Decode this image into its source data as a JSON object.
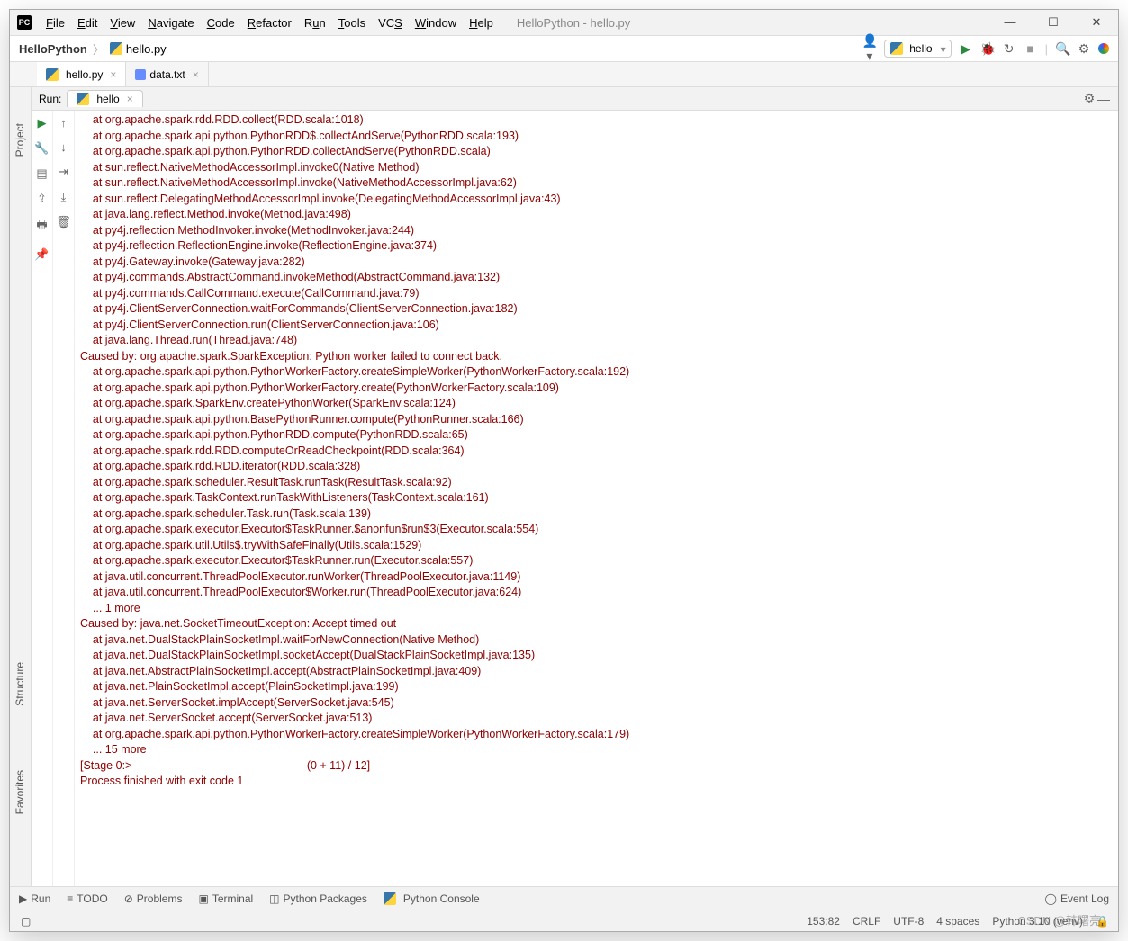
{
  "window": {
    "title_path": "HelloPython - hello.py"
  },
  "menu": [
    "File",
    "Edit",
    "View",
    "Navigate",
    "Code",
    "Refactor",
    "Run",
    "Tools",
    "VCS",
    "Window",
    "Help"
  ],
  "breadcrumb": {
    "root": "HelloPython",
    "file": "hello.py"
  },
  "run_config": "hello",
  "editor_tabs": [
    {
      "name": "hello.py",
      "kind": "py",
      "active": true
    },
    {
      "name": "data.txt",
      "kind": "txt",
      "active": false
    }
  ],
  "sidebars": {
    "project": "Project",
    "structure": "Structure",
    "favorites": "Favorites"
  },
  "run_panel": {
    "label": "Run:",
    "tab": "hello",
    "lines": [
      {
        "i": 1,
        "t": "    at org.apache.spark.rdd.RDD.collect(RDD.scala:1018)"
      },
      {
        "i": 1,
        "t": "    at org.apache.spark.api.python.PythonRDD$.collectAndServe(PythonRDD.scala:193)"
      },
      {
        "i": 1,
        "t": "    at org.apache.spark.api.python.PythonRDD.collectAndServe(PythonRDD.scala)"
      },
      {
        "i": 1,
        "t": "    at sun.reflect.NativeMethodAccessorImpl.invoke0(Native Method)"
      },
      {
        "i": 1,
        "t": "    at sun.reflect.NativeMethodAccessorImpl.invoke(NativeMethodAccessorImpl.java:62)"
      },
      {
        "i": 1,
        "t": "    at sun.reflect.DelegatingMethodAccessorImpl.invoke(DelegatingMethodAccessorImpl.java:43)"
      },
      {
        "i": 1,
        "t": "    at java.lang.reflect.Method.invoke(Method.java:498)"
      },
      {
        "i": 1,
        "t": "    at py4j.reflection.MethodInvoker.invoke(MethodInvoker.java:244)"
      },
      {
        "i": 1,
        "t": "    at py4j.reflection.ReflectionEngine.invoke(ReflectionEngine.java:374)"
      },
      {
        "i": 1,
        "t": "    at py4j.Gateway.invoke(Gateway.java:282)"
      },
      {
        "i": 1,
        "t": "    at py4j.commands.AbstractCommand.invokeMethod(AbstractCommand.java:132)"
      },
      {
        "i": 1,
        "t": "    at py4j.commands.CallCommand.execute(CallCommand.java:79)"
      },
      {
        "i": 1,
        "t": "    at py4j.ClientServerConnection.waitForCommands(ClientServerConnection.java:182)"
      },
      {
        "i": 1,
        "t": "    at py4j.ClientServerConnection.run(ClientServerConnection.java:106)"
      },
      {
        "i": 1,
        "t": "    at java.lang.Thread.run(Thread.java:748)"
      },
      {
        "i": 0,
        "t": "Caused by: org.apache.spark.SparkException: Python worker failed to connect back."
      },
      {
        "i": 1,
        "t": "    at org.apache.spark.api.python.PythonWorkerFactory.createSimpleWorker(PythonWorkerFactory.scala:192)"
      },
      {
        "i": 1,
        "t": "    at org.apache.spark.api.python.PythonWorkerFactory.create(PythonWorkerFactory.scala:109)"
      },
      {
        "i": 1,
        "t": "    at org.apache.spark.SparkEnv.createPythonWorker(SparkEnv.scala:124)"
      },
      {
        "i": 1,
        "t": "    at org.apache.spark.api.python.BasePythonRunner.compute(PythonRunner.scala:166)"
      },
      {
        "i": 1,
        "t": "    at org.apache.spark.api.python.PythonRDD.compute(PythonRDD.scala:65)"
      },
      {
        "i": 1,
        "t": "    at org.apache.spark.rdd.RDD.computeOrReadCheckpoint(RDD.scala:364)"
      },
      {
        "i": 1,
        "t": "    at org.apache.spark.rdd.RDD.iterator(RDD.scala:328)"
      },
      {
        "i": 1,
        "t": "    at org.apache.spark.scheduler.ResultTask.runTask(ResultTask.scala:92)"
      },
      {
        "i": 1,
        "t": "    at org.apache.spark.TaskContext.runTaskWithListeners(TaskContext.scala:161)"
      },
      {
        "i": 1,
        "t": "    at org.apache.spark.scheduler.Task.run(Task.scala:139)"
      },
      {
        "i": 1,
        "t": "    at org.apache.spark.executor.Executor$TaskRunner.$anonfun$run$3(Executor.scala:554)"
      },
      {
        "i": 1,
        "t": "    at org.apache.spark.util.Utils$.tryWithSafeFinally(Utils.scala:1529)"
      },
      {
        "i": 1,
        "t": "    at org.apache.spark.executor.Executor$TaskRunner.run(Executor.scala:557)"
      },
      {
        "i": 1,
        "t": "    at java.util.concurrent.ThreadPoolExecutor.runWorker(ThreadPoolExecutor.java:1149)"
      },
      {
        "i": 1,
        "t": "    at java.util.concurrent.ThreadPoolExecutor$Worker.run(ThreadPoolExecutor.java:624)"
      },
      {
        "i": 1,
        "t": "    ... 1 more"
      },
      {
        "i": 0,
        "t": "Caused by: java.net.SocketTimeoutException: Accept timed out"
      },
      {
        "i": 1,
        "t": "    at java.net.DualStackPlainSocketImpl.waitForNewConnection(Native Method)"
      },
      {
        "i": 1,
        "t": "    at java.net.DualStackPlainSocketImpl.socketAccept(DualStackPlainSocketImpl.java:135)"
      },
      {
        "i": 1,
        "t": "    at java.net.AbstractPlainSocketImpl.accept(AbstractPlainSocketImpl.java:409)"
      },
      {
        "i": 1,
        "t": "    at java.net.PlainSocketImpl.accept(PlainSocketImpl.java:199)"
      },
      {
        "i": 1,
        "t": "    at java.net.ServerSocket.implAccept(ServerSocket.java:545)"
      },
      {
        "i": 1,
        "t": "    at java.net.ServerSocket.accept(ServerSocket.java:513)"
      },
      {
        "i": 1,
        "t": "    at org.apache.spark.api.python.PythonWorkerFactory.createSimpleWorker(PythonWorkerFactory.scala:179)"
      },
      {
        "i": 1,
        "t": "    ... 15 more"
      },
      {
        "i": 0,
        "t": ""
      },
      {
        "i": 0,
        "t": "[Stage 0:>                                                        (0 + 11) / 12]"
      },
      {
        "i": 0,
        "t": "Process finished with exit code 1"
      },
      {
        "i": 0,
        "t": ""
      }
    ]
  },
  "footer": {
    "tools": [
      "Run",
      "TODO",
      "Problems",
      "Terminal",
      "Python Packages",
      "Python Console"
    ],
    "event_log": "Event Log"
  },
  "status": {
    "pos": "153:82",
    "sep": "CRLF",
    "enc": "UTF-8",
    "indent": "4 spaces",
    "interp": "Python 3.10 (venv)"
  },
  "watermark": "CSDN @韩曙亮"
}
